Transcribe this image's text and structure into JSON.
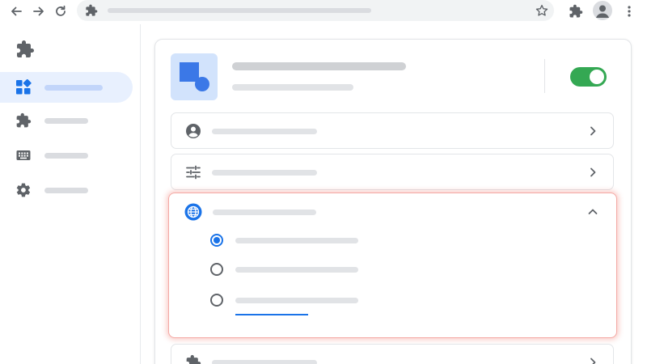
{
  "browser": {
    "nav_icons": [
      "back-arrow-icon",
      "forward-arrow-icon",
      "reload-icon"
    ],
    "omnibox_icon": "puzzle-icon",
    "bookmark_icon": "star-icon",
    "toolbar_icons": [
      "puzzle-icon",
      "avatar-icon",
      "kebab-menu-icon"
    ]
  },
  "sidebar": {
    "logo_icon": "puzzle-icon",
    "items": [
      {
        "icon": "dashboard-icon",
        "active": true
      },
      {
        "icon": "puzzle-icon",
        "active": false
      },
      {
        "icon": "keyboard-icon",
        "active": false
      },
      {
        "icon": "gear-icon",
        "active": false
      }
    ]
  },
  "extension": {
    "enabled": true,
    "tile_icon": "shapes-icon"
  },
  "rows": [
    {
      "icon": "account-circle-icon",
      "expanded": false
    },
    {
      "icon": "tune-sliders-icon",
      "expanded": false
    },
    {
      "icon": "globe-icon",
      "expanded": true,
      "options": [
        {
          "selected": true
        },
        {
          "selected": false
        },
        {
          "selected": false,
          "has_link": true
        }
      ]
    },
    {
      "icon": "puzzle-icon",
      "expanded": false
    }
  ],
  "colors": {
    "accent": "#1a73e8",
    "toggle_on": "#34a853",
    "highlight": "#ea4335",
    "active_nav_bg": "#e8f0fe"
  }
}
